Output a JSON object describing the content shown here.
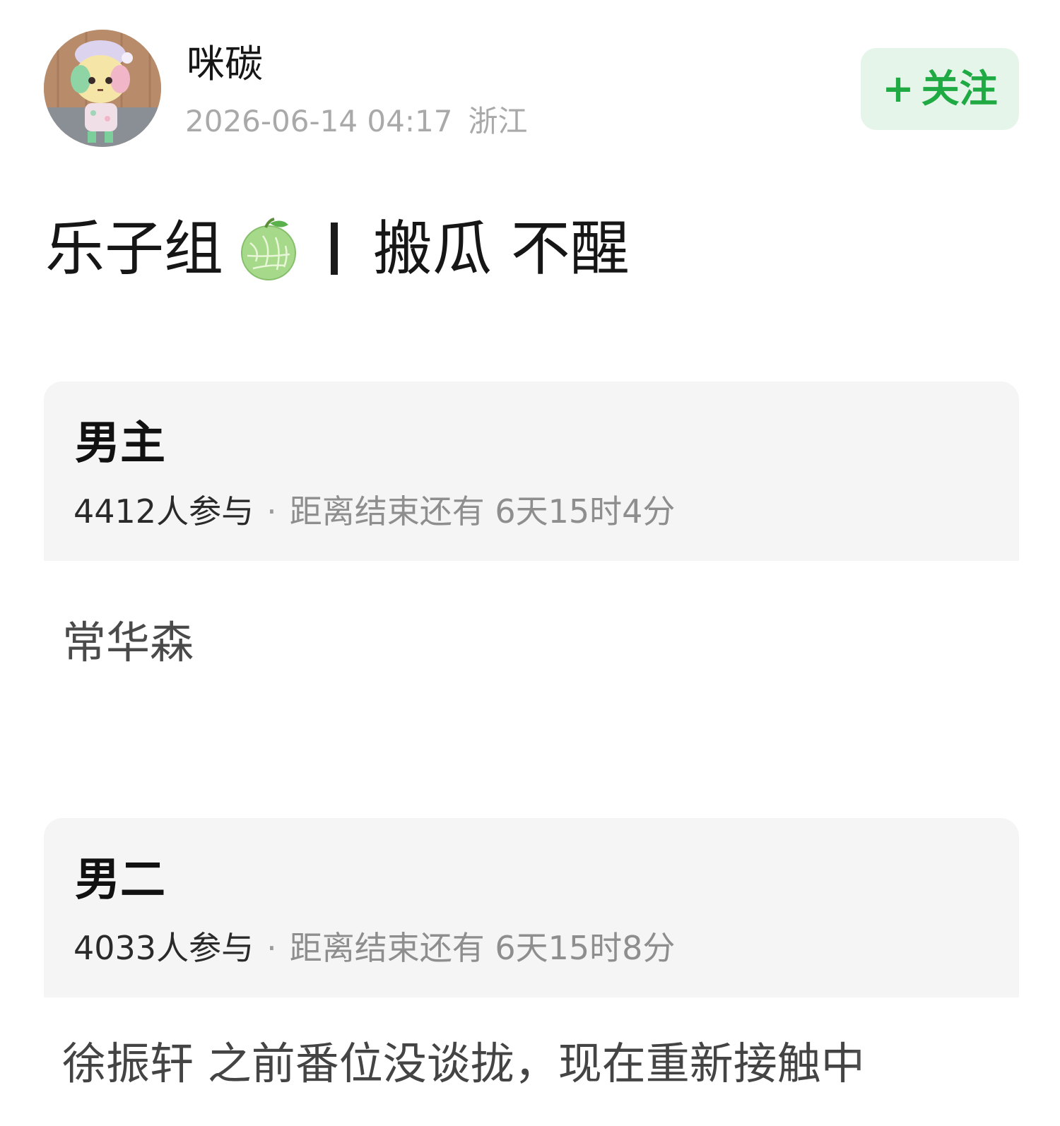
{
  "author": {
    "name": "咪碳",
    "timestamp": "2026-06-14 04:17",
    "location": "浙江"
  },
  "follow_button": {
    "plus": "+",
    "label": "关注"
  },
  "post": {
    "title_part1": "乐子组",
    "title_part2": "搬瓜 不醒"
  },
  "polls": [
    {
      "title": "男主",
      "participants": "4412人参与",
      "separator": "·",
      "countdown": "距离结束还有 6天15时4分",
      "answer": "常华森"
    },
    {
      "title": "男二",
      "participants": "4033人参与",
      "separator": "·",
      "countdown": "距离结束还有 6天15时8分",
      "answer": "徐振轩 之前番位没谈拢，现在重新接触中"
    }
  ],
  "icons": {
    "avatar": "animal-crossing-avatar",
    "title_emoji": "melon-icon"
  },
  "colors": {
    "accent_green": "#1faa44",
    "follow_bg": "#e6f5ea",
    "card_bg": "#f5f5f5",
    "meta_gray": "#a9a9a9"
  }
}
